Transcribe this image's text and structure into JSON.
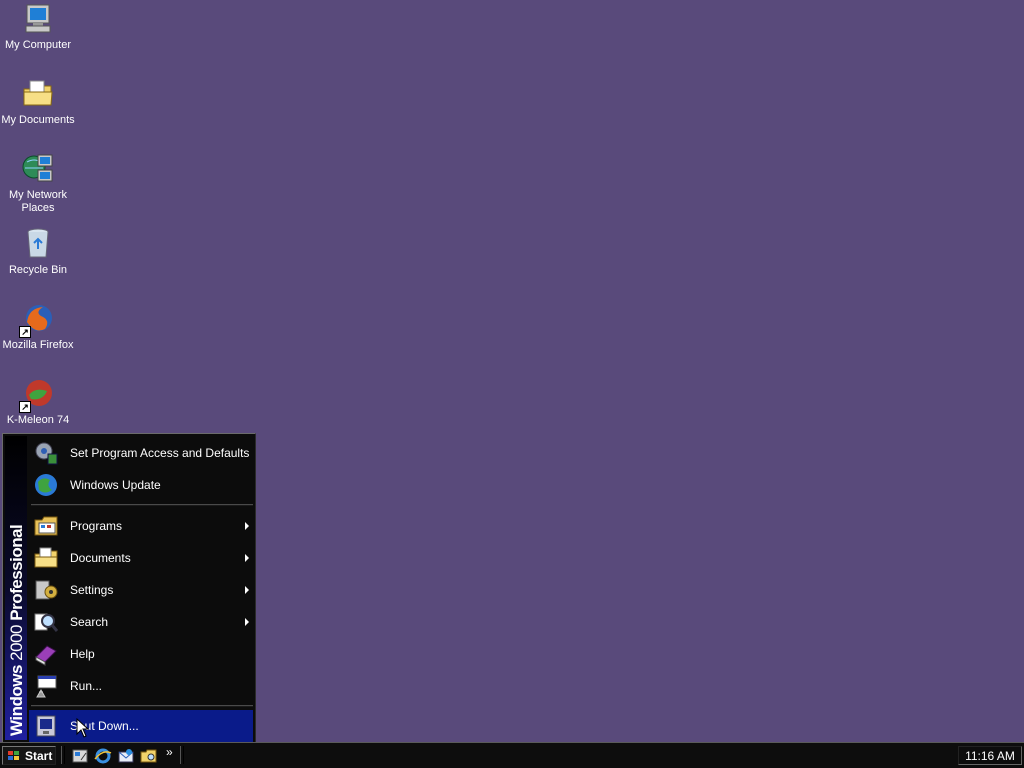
{
  "desktop": {
    "background_color": "#594a7b",
    "icons": [
      {
        "label": "My Computer",
        "icon": "computer-icon"
      },
      {
        "label": "My Documents",
        "icon": "documents-folder-icon"
      },
      {
        "label": "My Network\nPlaces",
        "icon": "network-places-icon"
      },
      {
        "label": "Recycle Bin",
        "icon": "recycle-bin-icon"
      },
      {
        "label": "Mozilla Firefox",
        "icon": "firefox-icon"
      },
      {
        "label": "K-Meleon 74",
        "icon": "k-meleon-icon"
      }
    ]
  },
  "start_menu": {
    "banner_bold": "Windows",
    "banner_thin": "2000",
    "banner_edition": "Professional",
    "items_top": [
      {
        "label": "Set Program Access and Defaults",
        "icon": "program-access-icon"
      },
      {
        "label": "Windows Update",
        "icon": "windows-update-icon"
      }
    ],
    "items_main": [
      {
        "label": "Programs",
        "icon": "programs-icon",
        "submenu": true
      },
      {
        "label": "Documents",
        "icon": "documents-icon",
        "submenu": true
      },
      {
        "label": "Settings",
        "icon": "settings-icon",
        "submenu": true
      },
      {
        "label": "Search",
        "icon": "search-icon",
        "submenu": true
      },
      {
        "label": "Help",
        "icon": "help-icon",
        "submenu": false
      },
      {
        "label": "Run...",
        "icon": "run-icon",
        "submenu": false
      }
    ],
    "item_bottom": {
      "label": "Shut Down...",
      "icon": "shut-down-icon",
      "selected": true
    },
    "selection_color": "#0a1b8a"
  },
  "taskbar": {
    "start_label": "Start",
    "quick_launch": [
      "show-desktop-icon",
      "internet-explorer-icon",
      "outlook-express-icon",
      "explorer-icon"
    ],
    "chevron": "»",
    "clock": "11:16 AM"
  }
}
